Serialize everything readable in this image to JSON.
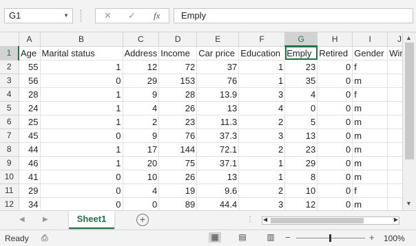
{
  "name_box": {
    "value": "G1"
  },
  "formula_bar": {
    "value": "Emply",
    "cancel_glyph": "✕",
    "enter_glyph": "✓",
    "fx_label": "fx"
  },
  "columns": [
    "",
    "A",
    "B",
    "C",
    "D",
    "E",
    "F",
    "G",
    "H",
    "I",
    "J"
  ],
  "header_row": [
    "Age",
    "Marital status",
    "Address",
    "Income",
    "Car price",
    "Education",
    "Emply",
    "Retired",
    "Gender",
    "Wirel"
  ],
  "rows": [
    {
      "num": "2",
      "cells": [
        "55",
        "1",
        "12",
        "72",
        "37",
        "1",
        "23",
        "0",
        "f"
      ]
    },
    {
      "num": "3",
      "cells": [
        "56",
        "0",
        "29",
        "153",
        "76",
        "1",
        "35",
        "0",
        "m"
      ]
    },
    {
      "num": "4",
      "cells": [
        "28",
        "1",
        "9",
        "28",
        "13.9",
        "3",
        "4",
        "0",
        "f"
      ]
    },
    {
      "num": "5",
      "cells": [
        "24",
        "1",
        "4",
        "26",
        "13",
        "4",
        "0",
        "0",
        "m"
      ]
    },
    {
      "num": "6",
      "cells": [
        "25",
        "1",
        "2",
        "23",
        "11.3",
        "2",
        "5",
        "0",
        "m"
      ]
    },
    {
      "num": "7",
      "cells": [
        "45",
        "0",
        "9",
        "76",
        "37.3",
        "3",
        "13",
        "0",
        "m"
      ]
    },
    {
      "num": "8",
      "cells": [
        "44",
        "1",
        "17",
        "144",
        "72.1",
        "2",
        "23",
        "0",
        "m"
      ]
    },
    {
      "num": "9",
      "cells": [
        "46",
        "1",
        "20",
        "75",
        "37.1",
        "1",
        "29",
        "0",
        "m"
      ]
    },
    {
      "num": "10",
      "cells": [
        "41",
        "0",
        "10",
        "26",
        "13",
        "1",
        "8",
        "0",
        "m"
      ]
    },
    {
      "num": "11",
      "cells": [
        "29",
        "0",
        "4",
        "19",
        "9.6",
        "2",
        "10",
        "0",
        "f"
      ]
    },
    {
      "num": "12",
      "cells": [
        "34",
        "0",
        "0",
        "89",
        "44.4",
        "3",
        "12",
        "0",
        "m"
      ]
    }
  ],
  "sheet_tab": {
    "label": "Sheet1"
  },
  "status": {
    "ready": "Ready",
    "zoom": "100%"
  },
  "colors": {
    "accent": "#217346"
  }
}
